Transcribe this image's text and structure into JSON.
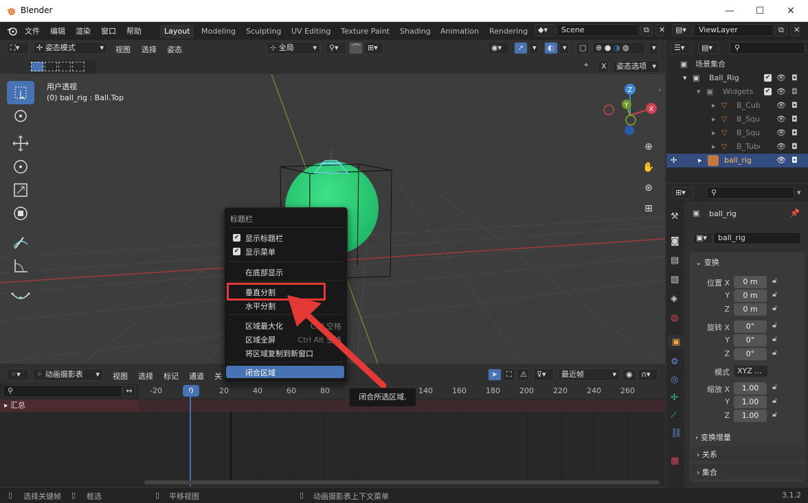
{
  "window": {
    "title": "Blender",
    "minimize": "—",
    "maximize": "☐",
    "close": "✕"
  },
  "menu": {
    "items": [
      "文件",
      "编辑",
      "渲染",
      "窗口",
      "帮助"
    ]
  },
  "workspaces": [
    "Layout",
    "Modeling",
    "Sculpting",
    "UV Editing",
    "Texture Paint",
    "Shading",
    "Animation",
    "Rendering"
  ],
  "scene": {
    "name": "Scene",
    "viewlayer": "ViewLayer"
  },
  "viewport": {
    "mode": "姿态模式",
    "menus": [
      "视图",
      "选择",
      "姿态"
    ],
    "transform_orientation": "全局",
    "pose_options": "姿态选项",
    "view_name": "用户透视",
    "object_info": "(0) ball_rig : Ball.Top",
    "gizmo": {
      "x": "X",
      "y": "Y",
      "z": "Z"
    }
  },
  "context_menu": {
    "title": "标题栏",
    "items": [
      {
        "label": "显示标题栏",
        "checked": true
      },
      {
        "label": "显示菜单",
        "checked": true
      },
      {
        "label": "在底部显示"
      },
      {
        "label": "垂直分割"
      },
      {
        "label": "水平分割"
      },
      {
        "label": "区域最大化",
        "shortcut": "Ctrl 空格"
      },
      {
        "label": "区域全屏",
        "shortcut": "Ctrl Alt 空格"
      },
      {
        "label": "将区域复制到新窗口"
      },
      {
        "label": "闭合区域",
        "highlighted": true
      }
    ],
    "tooltip": "闭合所选区域."
  },
  "timeline": {
    "editor": "动画摄影表",
    "menus": [
      "视图",
      "选择",
      "标记",
      "通道",
      "关"
    ],
    "mode": "最近帧",
    "current_frame": "0",
    "ticks": [
      "-20",
      "20",
      "40",
      "60",
      "80",
      "140",
      "160",
      "180",
      "200",
      "220",
      "240",
      "260"
    ],
    "summary": "汇总"
  },
  "outliner": {
    "rows": [
      {
        "label": "场景集合",
        "indent": 0
      },
      {
        "label": "Ball_Rig",
        "indent": 1
      },
      {
        "label": "Widgets",
        "indent": 2
      },
      {
        "label": "B_Cube",
        "indent": 3
      },
      {
        "label": "B_Squa",
        "indent": 3
      },
      {
        "label": "B_Squa",
        "indent": 3
      },
      {
        "label": "B_Tube",
        "indent": 3
      },
      {
        "label": "ball_rig",
        "indent": 1,
        "selected": true
      }
    ]
  },
  "properties": {
    "object_name": "ball_rig",
    "data_name": "ball_rig",
    "section_transform": "变换",
    "location_label": "位置 X",
    "rotation_label": "旋转 X",
    "scale_label": "缩放 X",
    "axis_y": "Y",
    "axis_z": "Z",
    "location": [
      "0 m",
      "0 m",
      "0 m"
    ],
    "rotation": [
      "0°",
      "0°",
      "0°"
    ],
    "mode_label": "模式",
    "mode_value": "XYZ ...",
    "scale": [
      "1.00",
      "1.00",
      "1.00"
    ],
    "delta": "变换增量",
    "relations": "关系",
    "collections": "集合"
  },
  "statusbar": {
    "select": "选择关键帧",
    "box": "框选",
    "pan": "平移视图",
    "context": "动画摄影表上下文菜单",
    "version": "3.1.2"
  },
  "colors": {
    "accent": "#4772b3",
    "highlight_box": "#e53935",
    "ball": "#2ecc71",
    "selected_row": "#334d80"
  }
}
